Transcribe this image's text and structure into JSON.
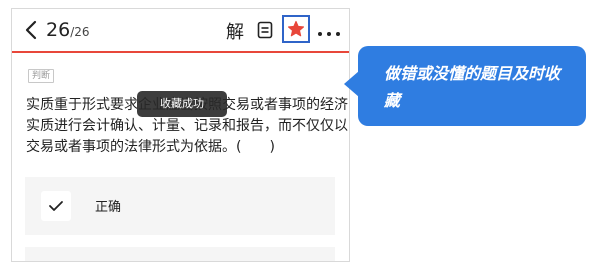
{
  "header": {
    "current": "26",
    "total": "/26",
    "analysis_label": "解",
    "icons": [
      "back-arrow-icon",
      "answer-sheet-icon",
      "star-favorite-icon",
      "more-icon"
    ],
    "favorite_color": "#e8473a",
    "highlight_color": "#2f64c8",
    "divider_color": "#e8473a"
  },
  "question": {
    "type_tag": "判断",
    "text": "实质重于形式要求企业应当按照交易或者事项的经济实质进行会计确认、计量、记录和报告，而不仅仅以交易或者事项的法律形式为依据。(　　)"
  },
  "toast": {
    "text": "收藏成功"
  },
  "options": [
    {
      "label": "正确",
      "icon": "check-icon"
    }
  ],
  "callout": {
    "text": "做错或没懂的题目及时收藏",
    "color": "#2f7de1"
  }
}
